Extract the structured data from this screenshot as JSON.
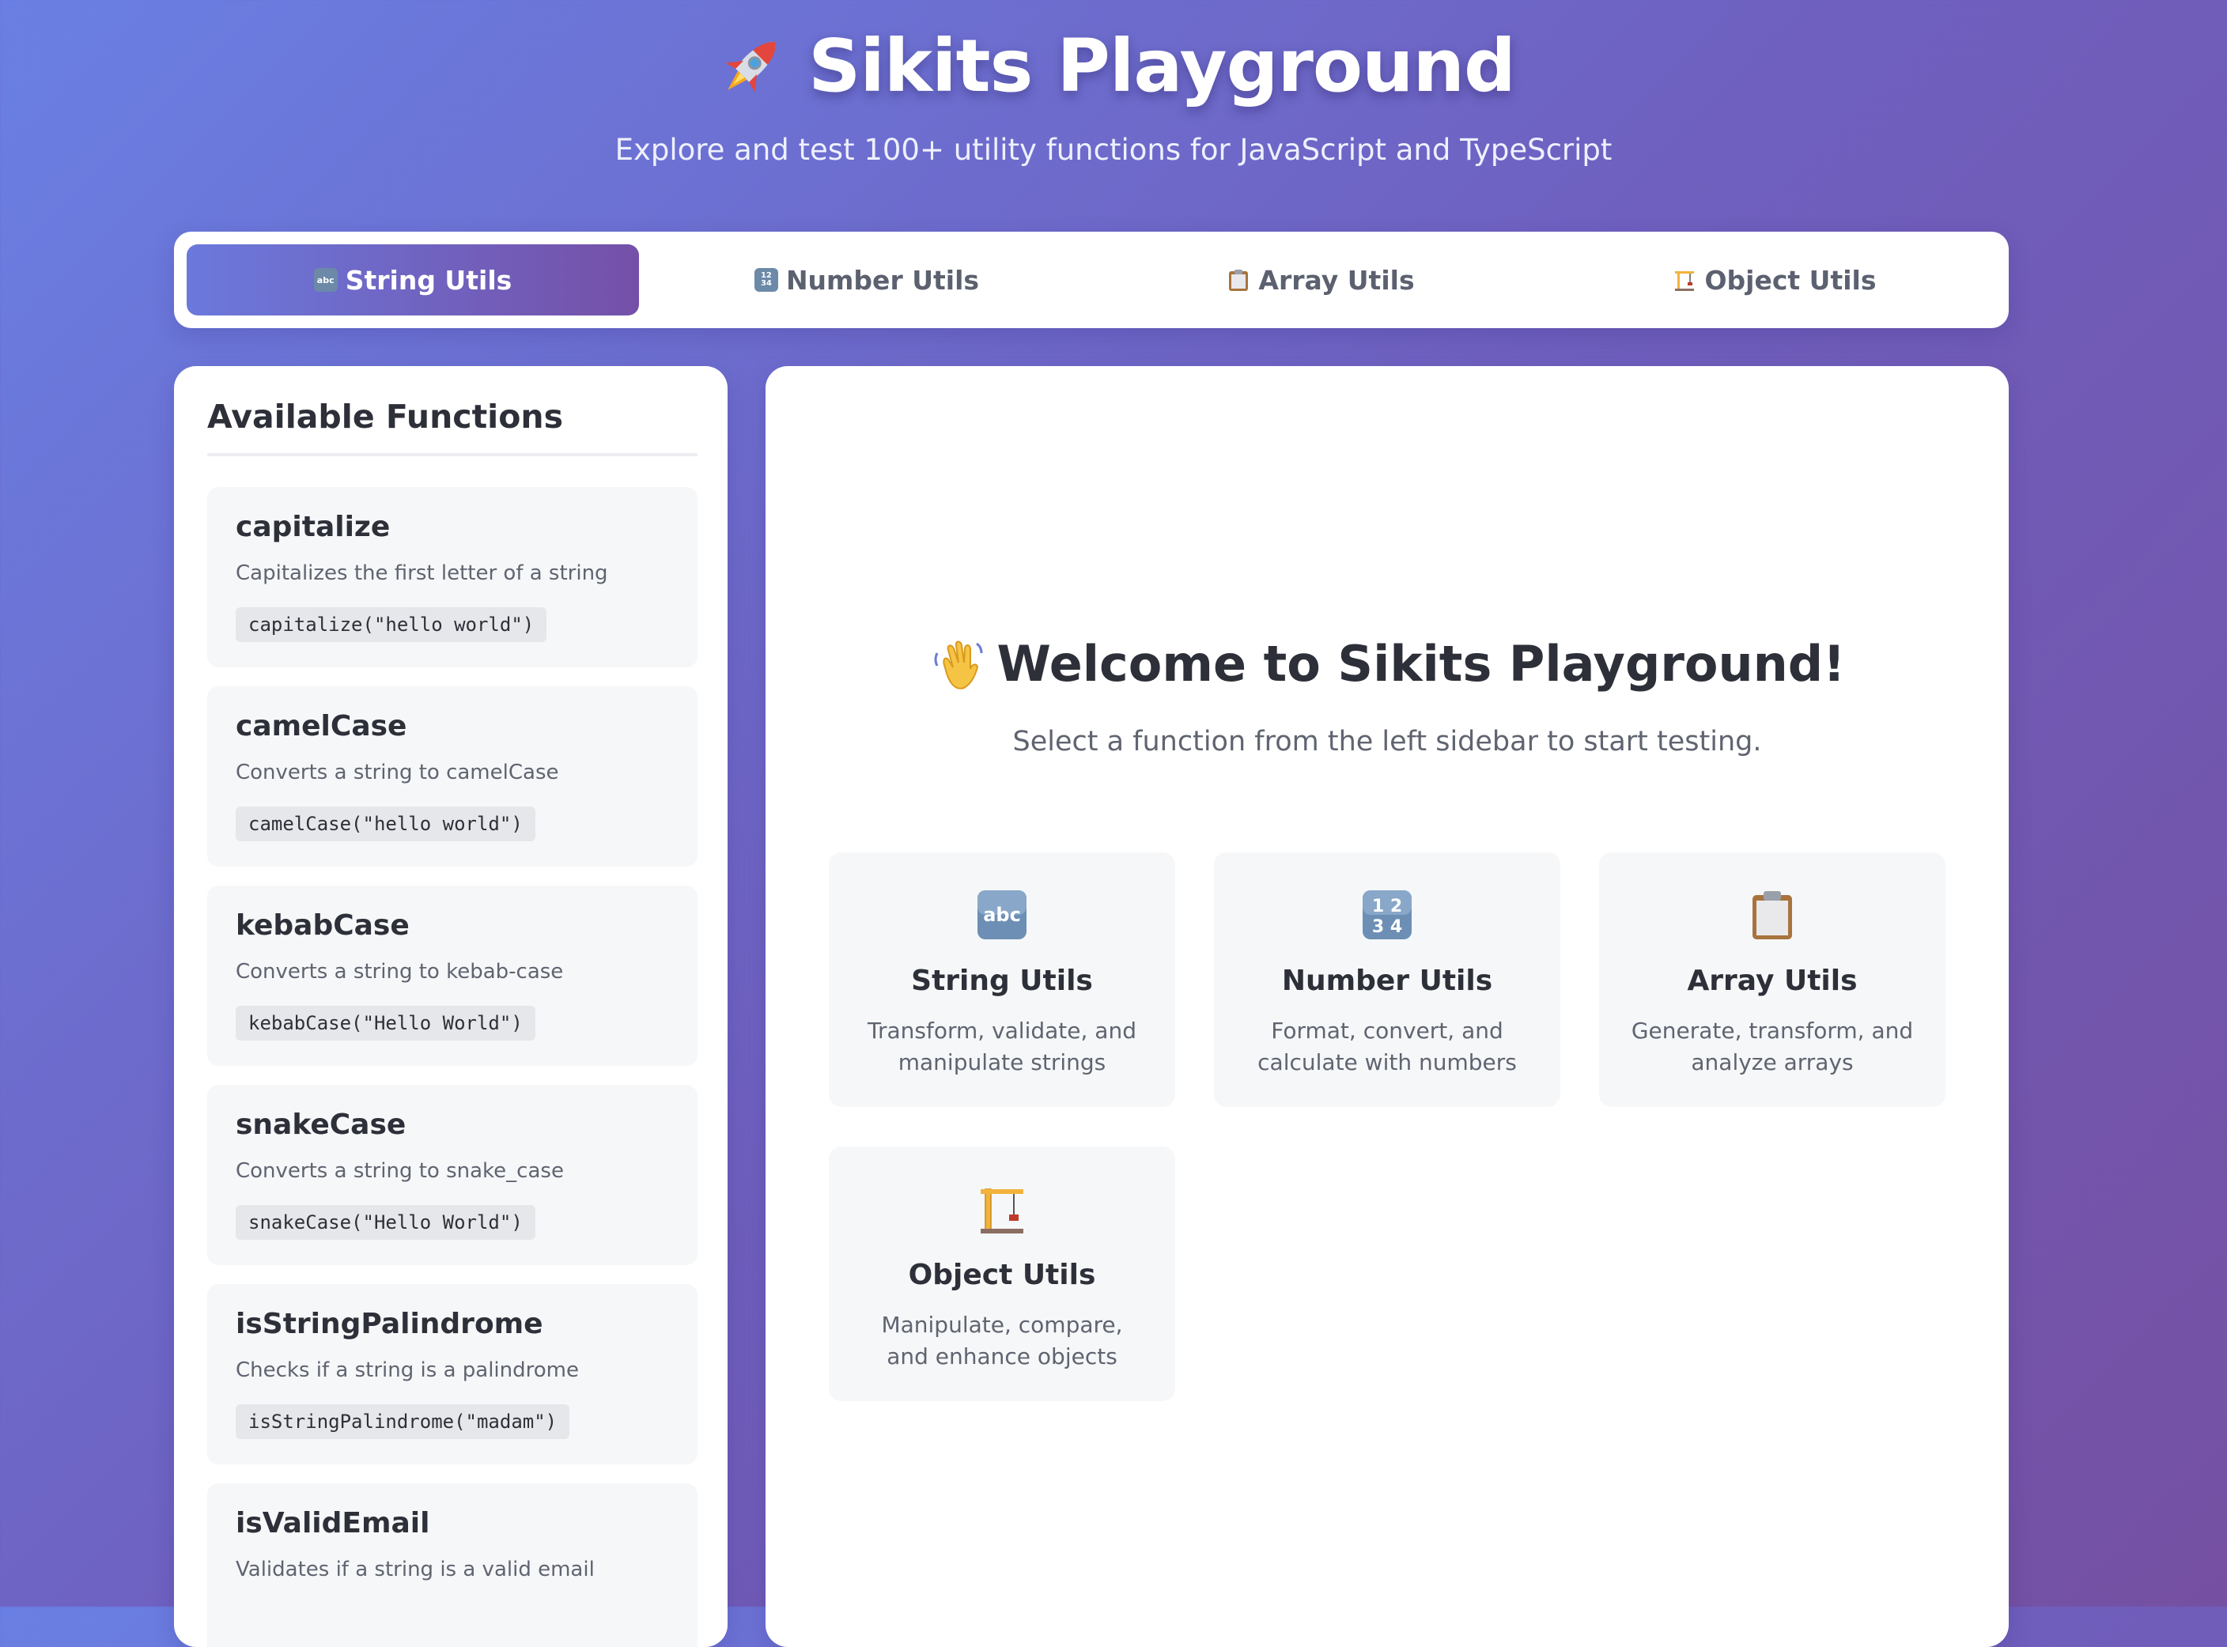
{
  "header": {
    "title": "Sikits Playground",
    "subtitle": "Explore and test 100+ utility functions for JavaScript and TypeScript",
    "icon": "rocket-icon"
  },
  "tabs": [
    {
      "label": "String Utils",
      "icon": "abc-icon",
      "active": true
    },
    {
      "label": "Number Utils",
      "icon": "numbers-icon",
      "active": false
    },
    {
      "label": "Array Utils",
      "icon": "clipboard-icon",
      "active": false
    },
    {
      "label": "Object Utils",
      "icon": "crane-icon",
      "active": false
    }
  ],
  "sidebar": {
    "title": "Available Functions",
    "functions": [
      {
        "name": "capitalize",
        "description": "Capitalizes the first letter of a string",
        "example": "capitalize(\"hello world\")"
      },
      {
        "name": "camelCase",
        "description": "Converts a string to camelCase",
        "example": "camelCase(\"hello world\")"
      },
      {
        "name": "kebabCase",
        "description": "Converts a string to kebab-case",
        "example": "kebabCase(\"Hello World\")"
      },
      {
        "name": "snakeCase",
        "description": "Converts a string to snake_case",
        "example": "snakeCase(\"Hello World\")"
      },
      {
        "name": "isStringPalindrome",
        "description": "Checks if a string is a palindrome",
        "example": "isStringPalindrome(\"madam\")"
      },
      {
        "name": "isValidEmail",
        "description": "Validates if a string is a valid email",
        "example": ""
      }
    ]
  },
  "main": {
    "welcome_title": "Welcome to Sikits Playground!",
    "welcome_subtitle": "Select a function from the left sidebar to start testing.",
    "welcome_icon": "waving-hand-icon",
    "categories": [
      {
        "title": "String Utils",
        "description": "Transform, validate, and manipulate strings",
        "icon": "abc-icon"
      },
      {
        "title": "Number Utils",
        "description": "Format, convert, and calculate with numbers",
        "icon": "numbers-icon"
      },
      {
        "title": "Array Utils",
        "description": "Generate, transform, and analyze arrays",
        "icon": "clipboard-icon"
      },
      {
        "title": "Object Utils",
        "description": "Manipulate, compare, and enhance objects",
        "icon": "crane-icon"
      }
    ]
  },
  "colors": {
    "accent_start": "#6b79dc",
    "accent_end": "#7550a8",
    "card_bg": "#f6f7f9"
  }
}
